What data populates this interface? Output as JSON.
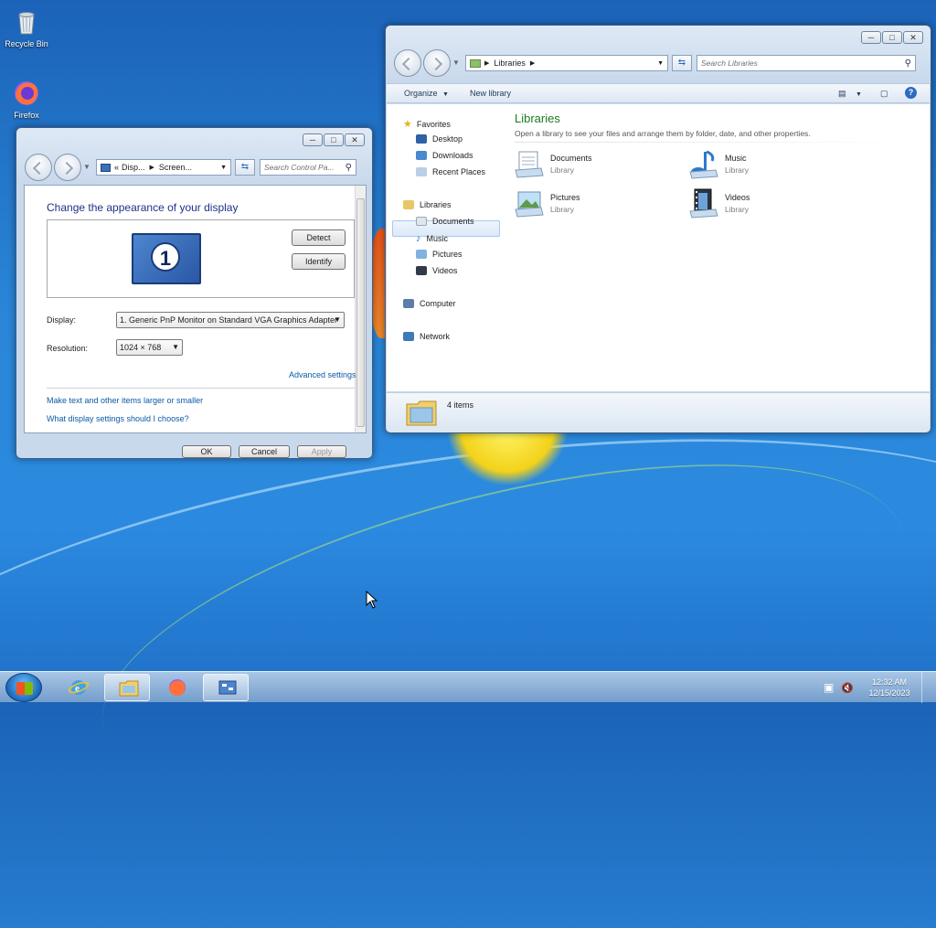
{
  "desktop": {
    "icons": [
      {
        "label": "Recycle Bin",
        "icon": "recycle-bin-icon"
      },
      {
        "label": "Firefox",
        "icon": "firefox-icon"
      }
    ]
  },
  "display_window": {
    "breadcrumb": [
      "Disp...",
      "Screen..."
    ],
    "breadcrumb_prefix": "«",
    "search_placeholder": "Search Control Pa...",
    "title": "Change the appearance of your display",
    "monitor_number": "1",
    "detect_label": "Detect",
    "identify_label": "Identify",
    "display_label": "Display:",
    "display_value": "1. Generic PnP Monitor on Standard VGA Graphics Adapter",
    "resolution_label": "Resolution:",
    "resolution_value": "1024 × 768",
    "advanced_link": "Advanced settings",
    "link_text_size": "Make text and other items larger or smaller",
    "link_help": "What display settings should I choose?",
    "ok_label": "OK",
    "cancel_label": "Cancel",
    "apply_label": "Apply"
  },
  "libraries_window": {
    "breadcrumb": "Libraries",
    "search_placeholder": "Search Libraries",
    "toolbar": {
      "organize": "Organize",
      "new_library": "New library"
    },
    "nav": {
      "favorites": "Favorites",
      "desktop": "Desktop",
      "downloads": "Downloads",
      "recent": "Recent Places",
      "libraries": "Libraries",
      "documents": "Documents",
      "music": "Music",
      "pictures": "Pictures",
      "videos": "Videos",
      "computer": "Computer",
      "network": "Network"
    },
    "heading": "Libraries",
    "subheading": "Open a library to see your files and arrange them by folder, date, and other properties.",
    "tiles": [
      {
        "name": "Documents",
        "type": "Library"
      },
      {
        "name": "Music",
        "type": "Library"
      },
      {
        "name": "Pictures",
        "type": "Library"
      },
      {
        "name": "Videos",
        "type": "Library"
      }
    ],
    "status": "4 items"
  },
  "taskbar": {
    "time": "12:32 AM",
    "date": "12/15/2023"
  }
}
